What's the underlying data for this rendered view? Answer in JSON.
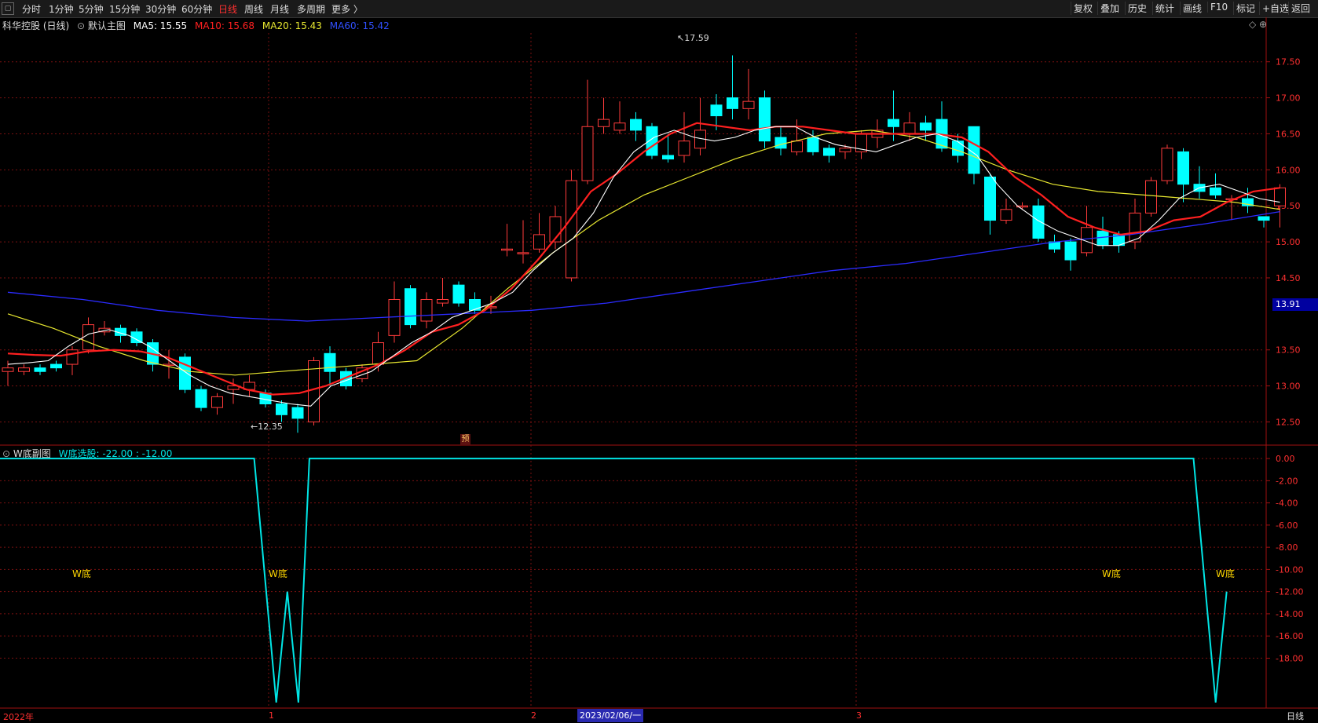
{
  "toolbar": {
    "periods": [
      "分时",
      "1分钟",
      "5分钟",
      "15分钟",
      "30分钟",
      "60分钟",
      "日线",
      "周线",
      "月线",
      "多周期",
      "更多 〉"
    ],
    "active_period": "日线",
    "right": [
      "复权",
      "叠加",
      "历史",
      "统计",
      "画线",
      "F10",
      "标记",
      "+自选",
      "返回"
    ]
  },
  "main_header": {
    "title": "科华控股 (日线)",
    "template": "默认主图",
    "ma5": "MA5: 15.55",
    "ma10": "MA10: 15.68",
    "ma20": "MA20: 15.43",
    "ma60": "MA60: 15.42"
  },
  "sub_header": {
    "title": "W底副图",
    "value": "W底选股: -22.00 : -12.00"
  },
  "colors": {
    "up": "#ff3b3b",
    "down": "#00ffff",
    "ma5": "#ffffff",
    "ma10": "#ff2020",
    "ma20": "#e8e830",
    "ma60": "#2b2bff",
    "grid": "#7a1010",
    "axis_text": "#ff3030",
    "sub_line": "#00e5e5"
  },
  "chart_data": [
    {
      "type": "candlestick",
      "title": "科华控股 (日线)",
      "ylim": [
        12.2,
        17.9
      ],
      "yticks": [
        17.5,
        17.0,
        16.5,
        16.0,
        15.5,
        15.0,
        14.5,
        13.5,
        13.0,
        12.5
      ],
      "ytick_labels": [
        "17.50",
        "17.00",
        "16.50",
        "16.00",
        "15.50",
        "15.00",
        "14.50",
        "13.50",
        "13.00",
        "12.50"
      ],
      "current_price": "13.91",
      "high_marker": "17.59",
      "low_marker": "12.35",
      "candles": [
        [
          13.2,
          13.25,
          13.0,
          13.35
        ],
        [
          13.2,
          13.25,
          13.15,
          13.3
        ],
        [
          13.25,
          13.2,
          13.15,
          13.3
        ],
        [
          13.3,
          13.25,
          13.2,
          13.35
        ],
        [
          13.3,
          13.5,
          13.15,
          13.55
        ],
        [
          13.5,
          13.85,
          13.45,
          13.95
        ],
        [
          13.75,
          13.8,
          13.7,
          13.9
        ],
        [
          13.8,
          13.7,
          13.6,
          13.85
        ],
        [
          13.75,
          13.6,
          13.55,
          13.8
        ],
        [
          13.6,
          13.3,
          13.2,
          13.65
        ],
        [
          13.3,
          13.3,
          13.1,
          13.5
        ],
        [
          13.4,
          12.95,
          12.9,
          13.45
        ],
        [
          12.95,
          12.7,
          12.65,
          13.0
        ],
        [
          12.7,
          12.85,
          12.6,
          12.9
        ],
        [
          12.95,
          13.0,
          12.75,
          13.1
        ],
        [
          12.95,
          13.05,
          12.85,
          13.15
        ],
        [
          12.9,
          12.75,
          12.7,
          12.95
        ],
        [
          12.75,
          12.6,
          12.5,
          12.8
        ],
        [
          12.7,
          12.55,
          12.35,
          12.75
        ],
        [
          12.5,
          13.35,
          12.45,
          13.4
        ],
        [
          13.45,
          13.2,
          13.0,
          13.55
        ],
        [
          13.2,
          13.0,
          12.95,
          13.25
        ],
        [
          13.1,
          13.25,
          13.05,
          13.3
        ],
        [
          13.3,
          13.6,
          13.2,
          13.75
        ],
        [
          13.7,
          14.2,
          13.6,
          14.45
        ],
        [
          14.35,
          13.85,
          13.8,
          14.4
        ],
        [
          13.9,
          14.2,
          13.8,
          14.3
        ],
        [
          14.15,
          14.2,
          14.1,
          14.5
        ],
        [
          14.4,
          14.15,
          14.1,
          14.45
        ],
        [
          14.2,
          14.05,
          14.0,
          14.3
        ],
        [
          14.1,
          14.1,
          14.0,
          14.25
        ],
        [
          14.9,
          14.9,
          14.8,
          15.25
        ],
        [
          14.85,
          14.85,
          14.7,
          15.3
        ],
        [
          14.9,
          15.1,
          14.85,
          15.4
        ],
        [
          15.0,
          15.35,
          14.9,
          15.5
        ],
        [
          14.5,
          15.85,
          14.45,
          16.0
        ],
        [
          15.85,
          16.6,
          15.8,
          17.25
        ],
        [
          16.6,
          16.7,
          16.5,
          17.0
        ],
        [
          16.55,
          16.65,
          16.5,
          16.95
        ],
        [
          16.7,
          16.55,
          16.4,
          16.8
        ],
        [
          16.6,
          16.2,
          16.15,
          16.65
        ],
        [
          16.2,
          16.15,
          16.1,
          16.5
        ],
        [
          16.2,
          16.4,
          16.1,
          16.8
        ],
        [
          16.3,
          16.55,
          16.2,
          17.0
        ],
        [
          16.9,
          16.75,
          16.55,
          17.05
        ],
        [
          17.0,
          16.85,
          16.7,
          17.59
        ],
        [
          16.85,
          16.95,
          16.7,
          17.4
        ],
        [
          17.0,
          16.4,
          16.3,
          17.1
        ],
        [
          16.45,
          16.3,
          16.2,
          16.6
        ],
        [
          16.25,
          16.4,
          16.2,
          16.7
        ],
        [
          16.45,
          16.25,
          16.2,
          16.55
        ],
        [
          16.3,
          16.2,
          16.1,
          16.35
        ],
        [
          16.25,
          16.3,
          16.15,
          16.35
        ],
        [
          16.25,
          16.5,
          16.15,
          16.55
        ],
        [
          16.45,
          16.55,
          16.3,
          16.7
        ],
        [
          16.7,
          16.6,
          16.4,
          17.1
        ],
        [
          16.5,
          16.65,
          16.4,
          16.8
        ],
        [
          16.65,
          16.55,
          16.4,
          16.75
        ],
        [
          16.7,
          16.3,
          16.25,
          16.95
        ],
        [
          16.4,
          16.2,
          16.1,
          16.5
        ],
        [
          16.6,
          15.95,
          15.8,
          16.6
        ],
        [
          15.9,
          15.3,
          15.1,
          15.95
        ],
        [
          15.3,
          15.45,
          15.25,
          15.6
        ],
        [
          15.5,
          15.5,
          15.45,
          15.55
        ],
        [
          15.5,
          15.05,
          15.0,
          15.6
        ],
        [
          15.0,
          14.9,
          14.85,
          15.1
        ],
        [
          15.0,
          14.75,
          14.6,
          15.05
        ],
        [
          14.85,
          15.2,
          14.8,
          15.5
        ],
        [
          15.15,
          14.95,
          14.9,
          15.35
        ],
        [
          15.1,
          14.95,
          14.85,
          15.15
        ],
        [
          15.0,
          15.4,
          14.9,
          15.6
        ],
        [
          15.4,
          15.85,
          15.35,
          15.9
        ],
        [
          15.85,
          16.3,
          15.8,
          16.35
        ],
        [
          16.25,
          15.8,
          15.55,
          16.3
        ],
        [
          15.8,
          15.7,
          15.6,
          16.05
        ],
        [
          15.75,
          15.65,
          15.6,
          15.95
        ],
        [
          15.6,
          15.6,
          15.3,
          15.65
        ],
        [
          15.6,
          15.5,
          15.4,
          15.75
        ],
        [
          15.35,
          15.3,
          15.2,
          15.35
        ],
        [
          15.5,
          15.75,
          15.2,
          15.8
        ]
      ],
      "ma5": [
        13.3,
        13.32,
        13.35,
        13.55,
        13.72,
        13.78,
        13.7,
        13.55,
        13.35,
        13.15,
        13.0,
        12.9,
        12.85,
        12.8,
        12.75,
        12.72,
        13.0,
        13.1,
        13.2,
        13.4,
        13.6,
        13.75,
        13.95,
        14.05,
        14.15,
        14.3,
        14.6,
        14.85,
        15.05,
        15.4,
        15.9,
        16.25,
        16.45,
        16.55,
        16.45,
        16.4,
        16.45,
        16.55,
        16.6,
        16.6,
        16.45,
        16.35,
        16.3,
        16.25,
        16.35,
        16.45,
        16.5,
        16.4,
        16.2,
        15.8,
        15.5,
        15.3,
        15.15,
        15.05,
        14.95,
        14.95,
        15.05,
        15.3,
        15.6,
        15.75,
        15.8,
        15.7,
        15.6,
        15.55
      ],
      "ma10": [
        13.45,
        13.43,
        13.42,
        13.48,
        13.5,
        13.48,
        13.4,
        13.25,
        13.1,
        12.95,
        12.88,
        12.9,
        13.0,
        13.15,
        13.3,
        13.5,
        13.75,
        13.85,
        14.05,
        14.35,
        14.75,
        15.2,
        15.7,
        15.95,
        16.25,
        16.5,
        16.65,
        16.6,
        16.55,
        16.6,
        16.6,
        16.55,
        16.5,
        16.5,
        16.5,
        16.5,
        16.45,
        16.25,
        15.9,
        15.65,
        15.35,
        15.2,
        15.1,
        15.15,
        15.3,
        15.35,
        15.55,
        15.7,
        15.75
      ],
      "ma20": [
        14.0,
        13.8,
        13.55,
        13.35,
        13.2,
        13.15,
        13.2,
        13.25,
        13.3,
        13.35,
        13.8,
        14.35,
        14.85,
        15.3,
        15.65,
        15.9,
        16.15,
        16.35,
        16.5,
        16.55,
        16.45,
        16.25,
        16.0,
        15.8,
        15.7,
        15.65,
        15.6,
        15.55,
        15.45
      ],
      "ma60": [
        14.3,
        14.2,
        14.05,
        13.95,
        13.9,
        13.95,
        14.0,
        14.05,
        14.15,
        14.3,
        14.45,
        14.6,
        14.7,
        14.85,
        15.0,
        15.1,
        15.25,
        15.42
      ]
    },
    {
      "type": "line",
      "title": "W底选股",
      "ylim": [
        -22.5,
        1.0
      ],
      "yticks": [
        0,
        -2,
        -4,
        -6,
        -8,
        -10,
        -12,
        -14,
        -16,
        -18
      ],
      "ytick_labels": [
        "0.00",
        "-2.00",
        "-4.00",
        "-6.00",
        "-8.00",
        "-10.00",
        "-12.00",
        "-14.00",
        "-16.00",
        "-18.00"
      ],
      "series": [
        {
          "x": [
            0,
            23,
            25,
            26,
            27,
            28,
            108,
            110,
            111
          ],
          "values": [
            0,
            0,
            -22,
            -12,
            -22,
            0,
            0,
            -22,
            -12
          ]
        }
      ],
      "annotations": [
        "W底",
        "W底",
        "W底",
        "W底"
      ]
    }
  ],
  "x_axis": {
    "labels": [
      "2022年",
      "1",
      "2",
      "3"
    ],
    "cursor_date": "2023/02/06/一",
    "period": "日线"
  },
  "markers": {
    "yu": "预"
  }
}
